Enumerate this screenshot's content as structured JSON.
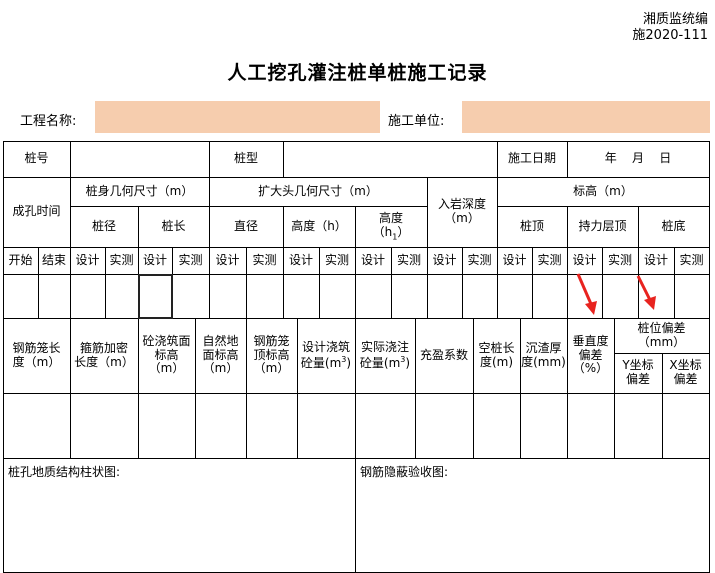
{
  "header": {
    "org": "湘质监统编",
    "code": "施2020-111",
    "title": "人工挖孔灌注桩单桩施工记录",
    "project_label": "工程名称:",
    "unit_label": "施工单位:"
  },
  "table": {
    "row1": {
      "pile_no": "桩号",
      "pile_type": "桩型",
      "date_label": "施工日期",
      "date_value": "年    月    日"
    },
    "hole_time": "成孔时间",
    "start": "开始",
    "end": "结束",
    "body_dims": "桩身几何尺寸（m）",
    "diameter": "桩径",
    "length": "桩长",
    "bell_dims": "扩大头几何尺寸（m）",
    "bell_diameter": "直径",
    "bell_height": "高度（h）",
    "bell_height1_prefix": "高度\n（h",
    "bell_height1_sub": "1",
    "bell_height1_suffix": "）",
    "rock_depth": "入岩深度\n（m）",
    "elevation": "标高（m）",
    "pile_top": "桩顶",
    "bearing_top": "持力层顶",
    "pile_bottom": "桩底",
    "design": "设计",
    "measured": "实测",
    "row_b": {
      "cage_length": "钢筋笼长\n度（m）",
      "stirrup_length": "箍筋加密\n长度（m）",
      "concrete_top": "砼浇筑面\n标高\n（m）",
      "natural_ground": "自然地\n面标高\n（m）",
      "cage_top": "钢筋笼\n顶标高\n（m）",
      "design_volume_prefix": "设计浇筑\n砼量(m",
      "design_volume_sup": "3",
      "actual_volume_prefix": "实际浇注\n砼量(m",
      "actual_volume_sup": "3",
      "fill_factor": "充盈系数",
      "empty_pile": "空桩长\n度(m)",
      "sediment": "沉渣厚\n度(mm)",
      "verticality": "垂直度\n偏差\n（%）",
      "position_dev": "桩位偏差\n（mm）",
      "y_dev": "Y坐标\n偏差",
      "x_dev": "X坐标\n偏差"
    },
    "geology_label": "桩孔地质结构柱状图:",
    "rebar_label": "钢筋隐蔽验收图:"
  },
  "colors": {
    "field_fill": "#f6cdae",
    "annotation_arrow": "#e8231f",
    "grid_line": "#000000"
  },
  "icons": [
    "red-arrow-icon",
    "red-arrow-icon"
  ]
}
